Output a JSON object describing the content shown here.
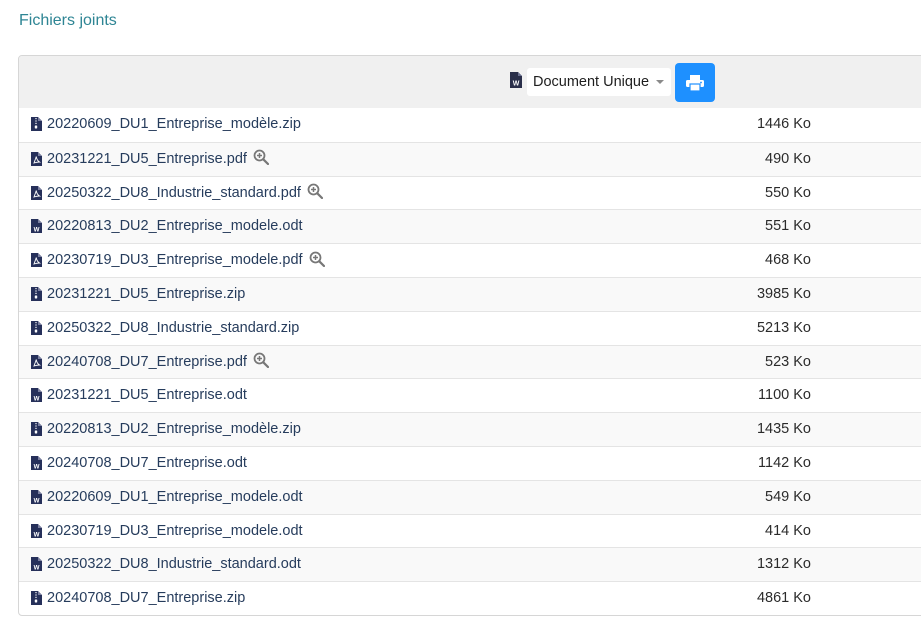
{
  "section": {
    "title": "Fichiers joints"
  },
  "toolbar": {
    "doc_type_icon": "file-word-icon",
    "select_value": "Document Unique",
    "print_icon": "print-icon",
    "print_color": "#1e90ff"
  },
  "files": [
    {
      "name": "20220609_DU1_Entreprise_modèle.zip",
      "size": "1446 Ko",
      "type": "zip",
      "preview": false
    },
    {
      "name": "20231221_DU5_Entreprise.pdf",
      "size": "490 Ko",
      "type": "pdf",
      "preview": true
    },
    {
      "name": "20250322_DU8_Industrie_standard.pdf",
      "size": "550 Ko",
      "type": "pdf",
      "preview": true
    },
    {
      "name": "20220813_DU2_Entreprise_modele.odt",
      "size": "551 Ko",
      "type": "odt",
      "preview": false
    },
    {
      "name": "20230719_DU3_Entreprise_modele.pdf",
      "size": "468 Ko",
      "type": "pdf",
      "preview": true
    },
    {
      "name": "20231221_DU5_Entreprise.zip",
      "size": "3985 Ko",
      "type": "zip",
      "preview": false
    },
    {
      "name": "20250322_DU8_Industrie_standard.zip",
      "size": "5213 Ko",
      "type": "zip",
      "preview": false
    },
    {
      "name": "20240708_DU7_Entreprise.pdf",
      "size": "523 Ko",
      "type": "pdf",
      "preview": true
    },
    {
      "name": "20231221_DU5_Entreprise.odt",
      "size": "1100 Ko",
      "type": "odt",
      "preview": false
    },
    {
      "name": "20220813_DU2_Entreprise_modèle.zip",
      "size": "1435 Ko",
      "type": "zip",
      "preview": false
    },
    {
      "name": "20240708_DU7_Entreprise.odt",
      "size": "1142 Ko",
      "type": "odt",
      "preview": false
    },
    {
      "name": "20220609_DU1_Entreprise_modele.odt",
      "size": "549 Ko",
      "type": "odt",
      "preview": false
    },
    {
      "name": "20230719_DU3_Entreprise_modele.odt",
      "size": "414 Ko",
      "type": "odt",
      "preview": false
    },
    {
      "name": "20250322_DU8_Industrie_standard.odt",
      "size": "1312 Ko",
      "type": "odt",
      "preview": false
    },
    {
      "name": "20240708_DU7_Entreprise.zip",
      "size": "4861 Ko",
      "type": "zip",
      "preview": false
    }
  ]
}
